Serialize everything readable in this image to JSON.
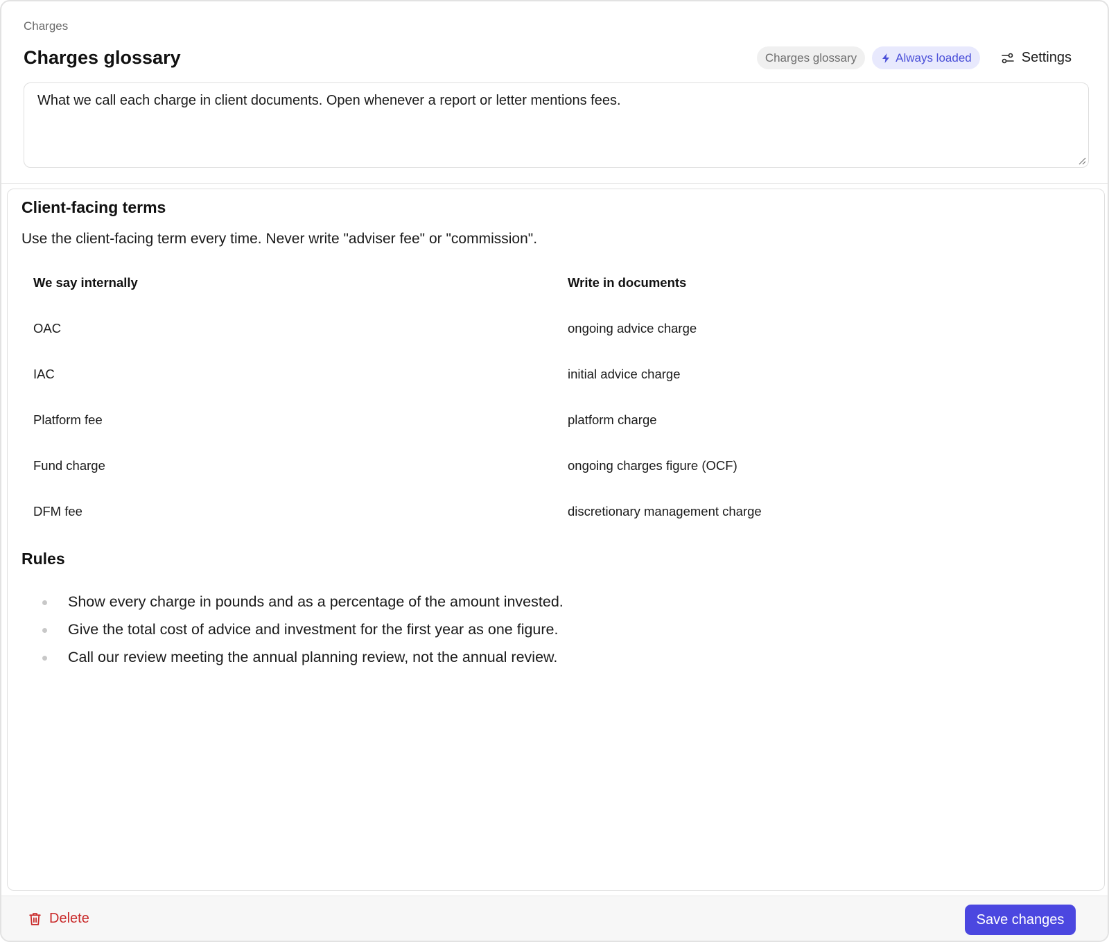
{
  "header": {
    "breadcrumb": "Charges",
    "title": "Charges glossary",
    "chips": {
      "name": "Charges glossary",
      "mode": "Always loaded",
      "mode_icon": "lightning-bolt-icon"
    },
    "settings_label": "Settings"
  },
  "description": "What we call each charge in client documents. Open whenever a report or letter mentions fees.",
  "content": {
    "terms_heading": "Client-facing terms",
    "terms_intro": "Use the client-facing term every time. Never write \"adviser fee\" or \"commission\".",
    "table": {
      "columns": [
        "We say internally",
        "Write in documents"
      ],
      "rows": [
        [
          "OAC",
          "ongoing advice charge"
        ],
        [
          "IAC",
          "initial advice charge"
        ],
        [
          "Platform fee",
          "platform charge"
        ],
        [
          "Fund charge",
          "ongoing charges figure (OCF)"
        ],
        [
          "DFM fee",
          "discretionary management charge"
        ]
      ]
    },
    "rules_heading": "Rules",
    "rules": [
      "Show every charge in pounds and as a percentage of the amount invested.",
      "Give the total cost of advice and investment for the first year as one figure.",
      "Call our review meeting the annual planning review, not the annual review."
    ]
  },
  "footer": {
    "delete_label": "Delete",
    "save_label": "Save changes"
  },
  "colors": {
    "accent": "#4b47e0",
    "chip_blue_text": "#4a4fd8",
    "danger": "#c92a2a"
  }
}
